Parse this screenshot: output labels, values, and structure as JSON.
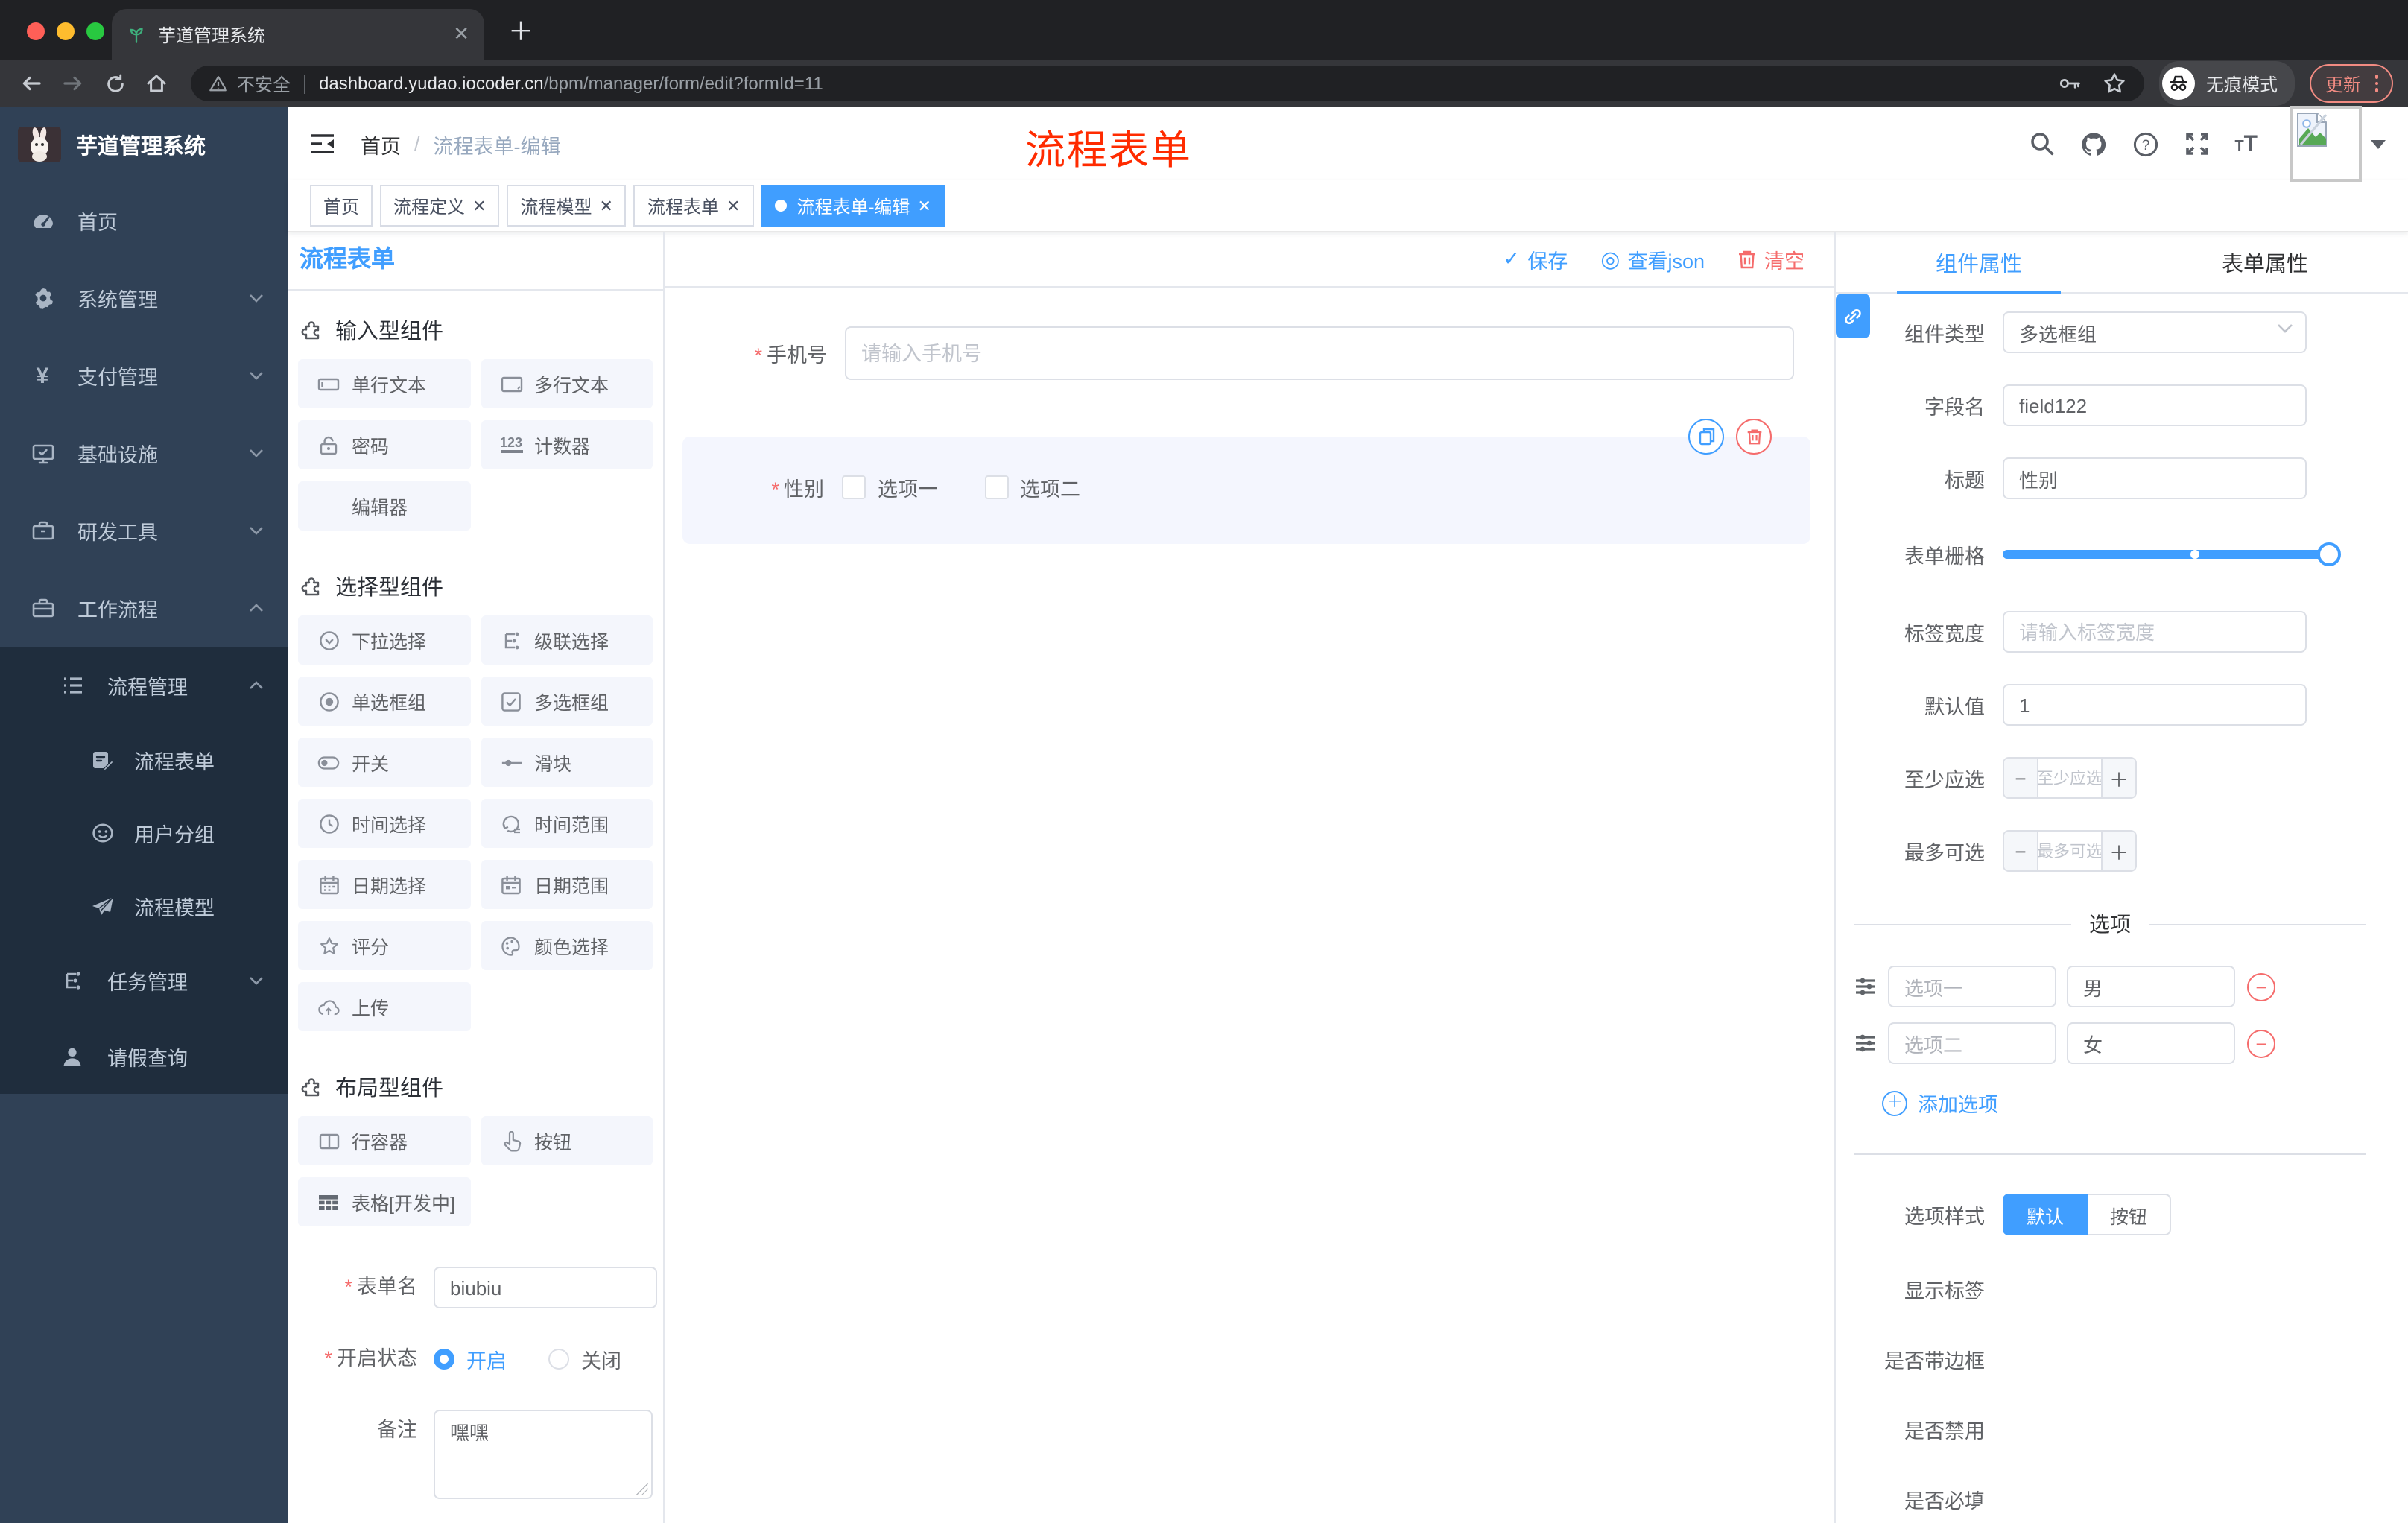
{
  "browser": {
    "tab_title": "芋道管理系统",
    "security_label": "不安全",
    "url_host": "dashboard.yudao.iocoder.cn",
    "url_path": "/bpm/manager/form/edit?formId=11",
    "incognito_label": "无痕模式",
    "update_label": "更新"
  },
  "sidebar": {
    "logo_title": "芋道管理系统",
    "items": [
      {
        "label": "首页"
      },
      {
        "label": "系统管理"
      },
      {
        "label": "支付管理"
      },
      {
        "label": "基础设施"
      },
      {
        "label": "研发工具"
      },
      {
        "label": "工作流程"
      }
    ],
    "submenu": {
      "group1": "流程管理",
      "children": [
        "流程表单",
        "用户分组",
        "流程模型"
      ],
      "group2": "任务管理",
      "leaf": "请假查询"
    }
  },
  "header": {
    "crumb1": "首页",
    "crumb2": "流程表单-编辑",
    "watermark": "流程表单"
  },
  "tags": [
    "首页",
    "流程定义",
    "流程模型",
    "流程表单",
    "流程表单-编辑"
  ],
  "palette": {
    "title": "流程表单",
    "s1": {
      "title": "输入型组件",
      "items": [
        "单行文本",
        "多行文本",
        "密码",
        "计数器",
        "编辑器"
      ]
    },
    "s2": {
      "title": "选择型组件",
      "items": [
        "下拉选择",
        "级联选择",
        "单选框组",
        "多选框组",
        "开关",
        "滑块",
        "时间选择",
        "时间范围",
        "日期选择",
        "日期范围",
        "评分",
        "颜色选择",
        "上传"
      ]
    },
    "s3": {
      "title": "布局型组件",
      "items": [
        "行容器",
        "按钮",
        "表格[开发中]"
      ]
    },
    "form": {
      "name_label": "表单名",
      "name_value": "biubiu",
      "status_label": "开启状态",
      "status_on": "开启",
      "status_off": "关闭",
      "remark_label": "备注",
      "remark_value": "嘿嘿"
    }
  },
  "canvas": {
    "save": "保存",
    "view_json": "查看json",
    "clear": "清空",
    "phone": {
      "label": "手机号",
      "placeholder": "请输入手机号"
    },
    "gender": {
      "label": "性别",
      "opt1": "选项一",
      "opt2": "选项二"
    }
  },
  "inspector": {
    "tab1": "组件属性",
    "tab2": "表单属性",
    "type_label": "组件类型",
    "type_value": "多选框组",
    "field_label": "字段名",
    "field_value": "field122",
    "title_label": "标题",
    "title_value": "性别",
    "grid_label": "表单栅格",
    "width_label": "标签宽度",
    "width_placeholder": "请输入标签宽度",
    "default_label": "默认值",
    "default_value": "1",
    "min_label": "至少应选",
    "min_placeholder": "至少应选",
    "max_label": "最多可选",
    "max_placeholder": "最多可选",
    "options_title": "选项",
    "opt1_label": "选项一",
    "opt1_value": "男",
    "opt2_label": "选项二",
    "opt2_value": "女",
    "add_option": "添加选项",
    "style_label": "选项样式",
    "style_default": "默认",
    "style_button": "按钮",
    "sw1": "显示标签",
    "sw2": "是否带边框",
    "sw3": "是否禁用",
    "sw4": "是否必填"
  },
  "colors": {
    "primary": "#409eff",
    "danger": "#f56c6c",
    "sidebar_bg": "#304156",
    "sidebar_sub_bg": "#1f2d3d",
    "watermark_red": "#ff2b00"
  }
}
